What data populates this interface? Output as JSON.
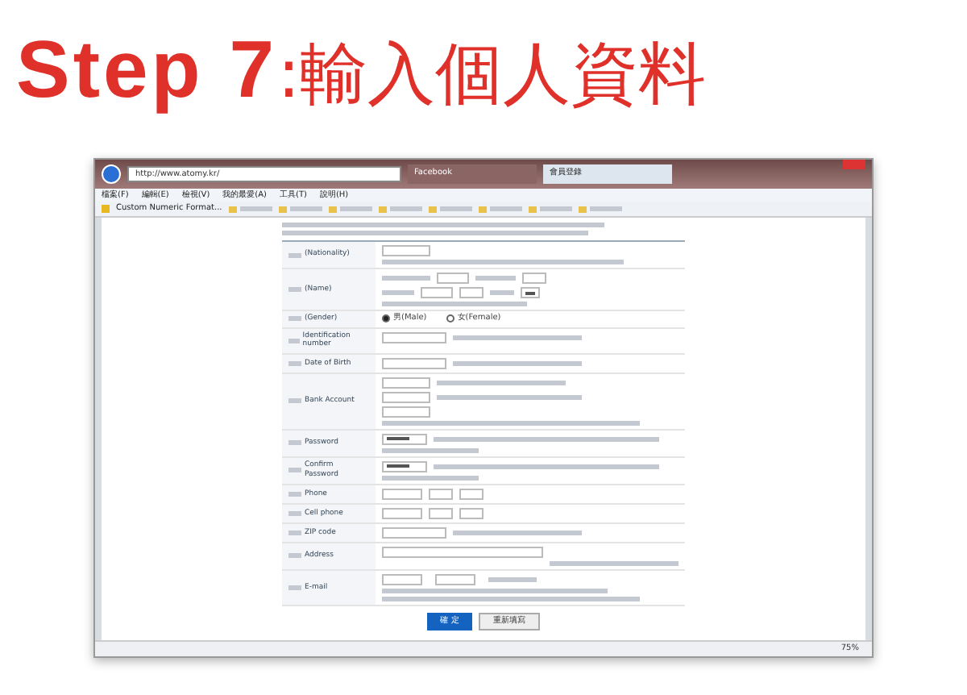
{
  "title": {
    "step": "Step 7",
    "text": ":輸入個人資料"
  },
  "browser": {
    "address": "http://www.atomy.kr/",
    "tabs": [
      {
        "label": "Facebook",
        "selected": false
      },
      {
        "label": "會員登錄",
        "selected": true
      }
    ],
    "menu": [
      "檔案(F)",
      "編輯(E)",
      "檢視(V)",
      "我的最愛(A)",
      "工具(T)",
      "說明(H)"
    ],
    "favorite": "Custom Numeric Format...",
    "zoom": "75%"
  },
  "form": {
    "rows": [
      {
        "label": "(Nationality)",
        "kind": "select"
      },
      {
        "label": "(Name)",
        "kind": "name"
      },
      {
        "label": "(Gender)",
        "kind": "radio",
        "options": [
          {
            "label": "男(Male)",
            "selected": true
          },
          {
            "label": "女(Female)",
            "selected": false
          }
        ]
      },
      {
        "label": "Identification number",
        "kind": "text"
      },
      {
        "label": "Date of Birth",
        "kind": "text"
      },
      {
        "label": "Bank Account",
        "kind": "bank"
      },
      {
        "label": "Password",
        "kind": "password"
      },
      {
        "label": "Confirm Password",
        "kind": "password"
      },
      {
        "label": "Phone",
        "kind": "phone"
      },
      {
        "label": "Cell phone",
        "kind": "phone"
      },
      {
        "label": "ZIP code",
        "kind": "text"
      },
      {
        "label": "Address",
        "kind": "address"
      },
      {
        "label": "E-mail",
        "kind": "email"
      }
    ],
    "buttons": [
      {
        "label": "確 定",
        "primary": true
      },
      {
        "label": "重新填寫",
        "primary": false
      }
    ]
  }
}
